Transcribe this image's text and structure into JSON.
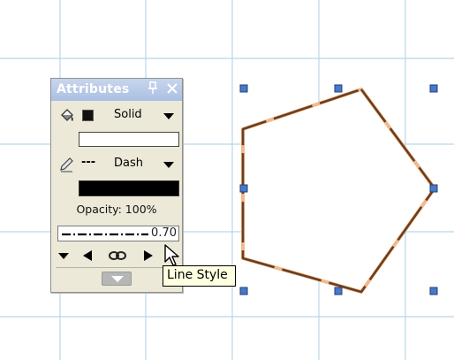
{
  "palette": {
    "title": "Attributes",
    "fill_style": "Solid",
    "stroke_style_pattern": "---",
    "stroke_style": "Dash",
    "opacity_label": "Opacity: 100%",
    "line_width_value": "0.70"
  },
  "tooltip": {
    "text": "Line Style"
  },
  "colors": {
    "grid": "#b7d7e8",
    "shape_stroke_dark": "#6b3e1e",
    "shape_stroke_light": "#f1b98c",
    "selection_handle": "#4a78c8",
    "fill_color": "#ffffff",
    "stroke_color": "#000000"
  },
  "icons": {
    "fill": "paint-bucket-icon",
    "stroke": "pencil-icon",
    "pin": "pin-icon",
    "close": "close-icon",
    "link": "link-icon",
    "cursor": "arrow-cursor-icon"
  }
}
